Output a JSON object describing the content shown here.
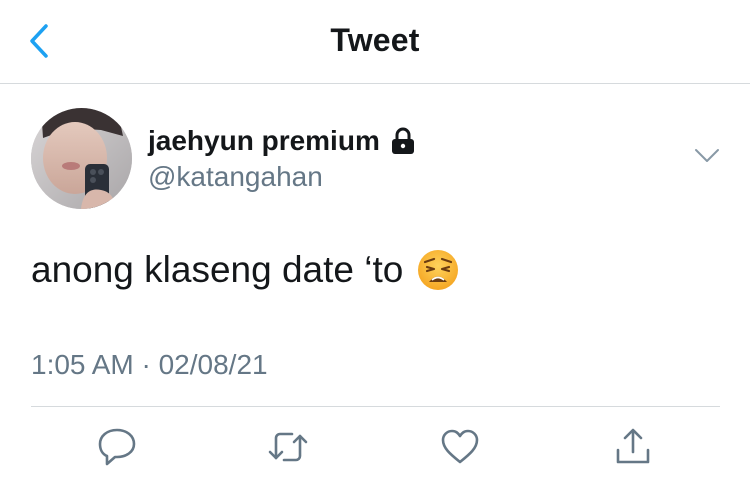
{
  "header": {
    "title": "Tweet",
    "back_icon": "chevron-left-icon",
    "accent_color": "#1da1f2"
  },
  "tweet": {
    "author": {
      "display_name": "jaehyun premium",
      "handle": "@katangahan",
      "protected_icon": "lock-icon"
    },
    "text": "anong klaseng date ‘to",
    "emoji": "weary-face",
    "timestamp": "1:05 AM · 02/08/21"
  },
  "actions": [
    {
      "name": "reply",
      "icon": "reply-icon"
    },
    {
      "name": "retweet",
      "icon": "retweet-icon"
    },
    {
      "name": "like",
      "icon": "heart-icon"
    },
    {
      "name": "share",
      "icon": "share-icon"
    }
  ],
  "colors": {
    "text": "#14171a",
    "secondary": "#657786",
    "divider": "#d6dadd"
  }
}
